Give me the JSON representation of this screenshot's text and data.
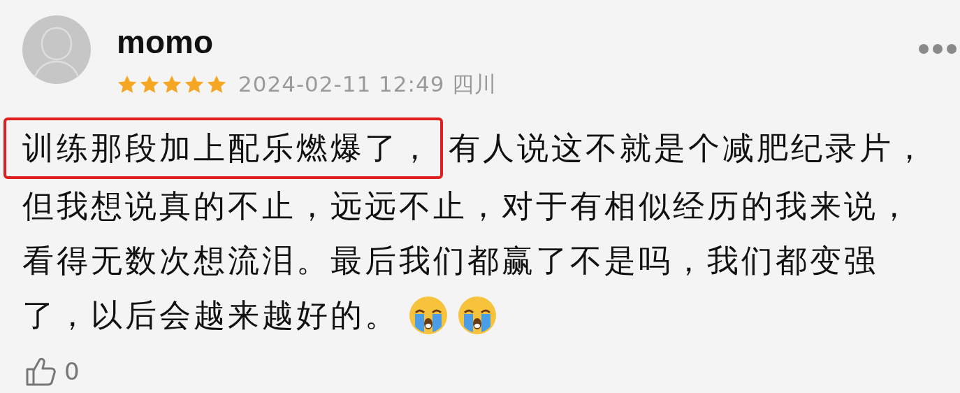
{
  "comment": {
    "user": "momo",
    "stars": 5,
    "time": "2024-02-11 12:49",
    "location": "四川",
    "highlight": "训练那段加上配乐燃爆了，",
    "lines": [
      "有人说这不就是个减肥纪录片，",
      "但我想说真的不止，远远不止，对于有相似经历的我来说，",
      "看得无数次想流泪。最后我们都赢了不是吗，我们都变强",
      "了，以后会越来越好的。"
    ],
    "emojis": [
      {
        "kind": "crying-face"
      },
      {
        "kind": "crying-face"
      }
    ],
    "likes": "0"
  }
}
